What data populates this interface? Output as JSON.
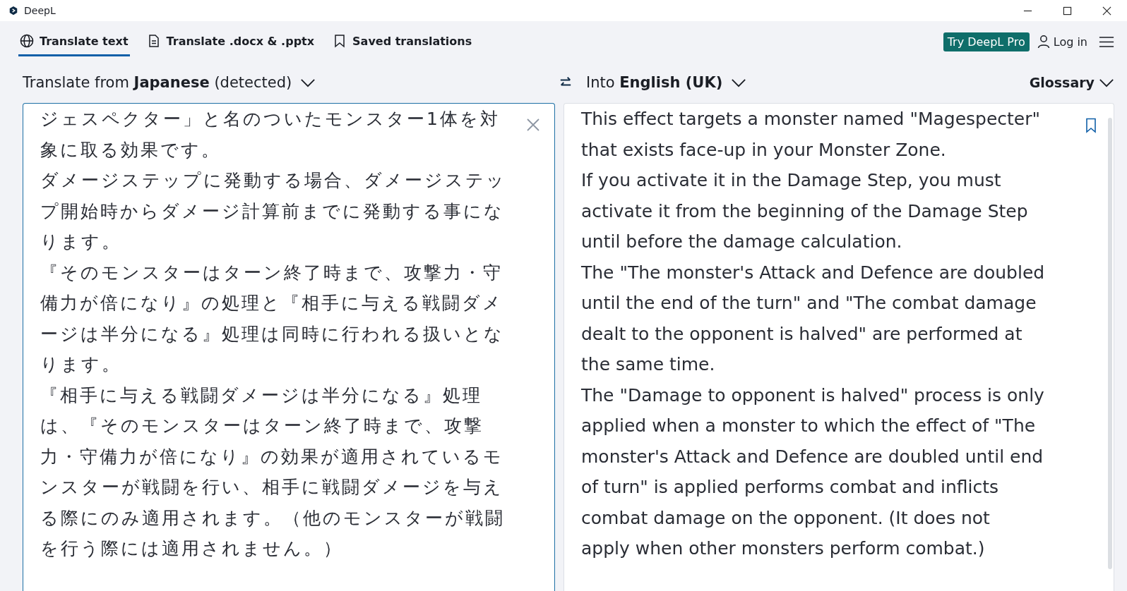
{
  "window": {
    "title": "DeepL"
  },
  "tabs": [
    {
      "label": "Translate text",
      "selected": true
    },
    {
      "label": "Translate .docx & .pptx",
      "selected": false
    },
    {
      "label": "Saved translations",
      "selected": false
    }
  ],
  "header": {
    "pro_button": "Try DeepL Pro",
    "login": "Log in"
  },
  "source": {
    "language_label": "Translate from **Japanese** (detected)",
    "lines": [
      "ジェスペクター」と名のついたモンスター1体を対",
      "象に取る効果です。",
      "ダメージステップに発動する場合、ダメージステッ",
      "プ開始時からダメージ計算前までに発動する事にな",
      "ります。",
      "『そのモンスターはターン終了時まで、攻撃力・守",
      "備力が倍になり』の処理と『相手に与える戦闘ダメ",
      "ージは半分になる』処理は同時に行われる扱いとな",
      "ります。",
      "『相手に与える戦闘ダメージは半分になる』処理",
      "は、『そのモンスターはターン終了時まで、攻撃",
      "力・守備力が倍になり』の効果が適用されているモ",
      "ンスターが戦闘を行い、相手に戦闘ダメージを与え",
      "る際にのみ適用されます。（他のモンスターが戦闘",
      "を行う際には適用されません。）"
    ]
  },
  "target": {
    "language_label": "Into **English (UK)**",
    "glossary": "Glossary",
    "lines": [
      "This effect targets a monster named \"Magespecter\"",
      "that exists face-up in your Monster Zone.",
      "If you activate it in the Damage Step, you must",
      "activate it from the beginning of the Damage Step",
      "until before the damage calculation.",
      "The \"The monster's Attack and Defence are doubled",
      "until the end of the turn\" and \"The combat damage",
      "dealt to the opponent is halved\" are performed at",
      "the same time.",
      "The \"Damage to opponent is halved\" process is only",
      "applied when a monster to which the effect of \"The",
      "monster's Attack and Defence are doubled until end",
      "of turn\" is applied performs combat and inflicts",
      "combat damage on the opponent. (It does not",
      "apply when other monsters perform combat.)"
    ]
  }
}
